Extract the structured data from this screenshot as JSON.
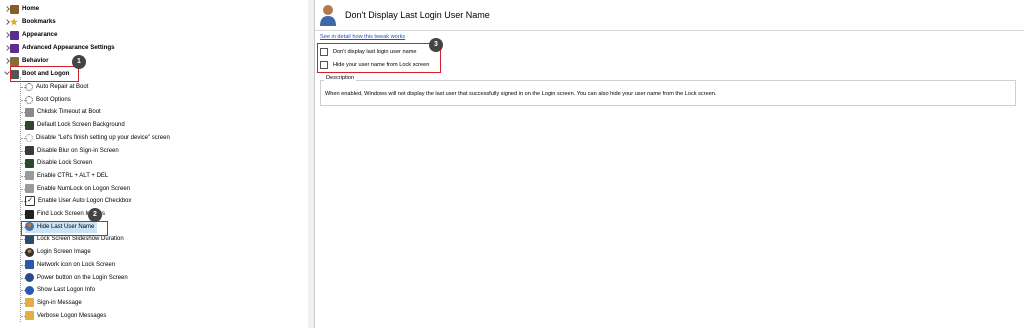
{
  "tree": {
    "top_items": [
      {
        "label": "Home",
        "icon": "home-icon",
        "color": "#8a5a2b"
      },
      {
        "label": "Bookmarks",
        "icon": "star-icon",
        "color": "#e8a317"
      },
      {
        "label": "Appearance",
        "icon": "palette-icon",
        "color": "#5b2d90"
      },
      {
        "label": "Advanced Appearance Settings",
        "icon": "palette-icon",
        "color": "#5b2d90"
      },
      {
        "label": "Behavior",
        "icon": "behavior-icon",
        "color": "#8a6a3a"
      },
      {
        "label": "Boot and Logon",
        "icon": "boot-logon-icon",
        "color": "#555555"
      }
    ],
    "children": [
      {
        "label": "Auto Repair at Boot",
        "icon": "dots-icon",
        "color": "#444444"
      },
      {
        "label": "Boot Options",
        "icon": "dots-icon",
        "color": "#444444"
      },
      {
        "label": "Chkdsk Timeout at Boot",
        "icon": "drive-icon",
        "color": "#8a8a8a"
      },
      {
        "label": "Default Lock Screen Background",
        "icon": "lock-screen-icon",
        "color": "#2a4a2a"
      },
      {
        "label": "Disable \"Let's finish setting up your device\" screen",
        "icon": "dots-icon",
        "color": "#8a8a8a"
      },
      {
        "label": "Disable Blur on Sign-in Screen",
        "icon": "image-icon",
        "color": "#3a3a3a"
      },
      {
        "label": "Disable Lock Screen",
        "icon": "lock-screen-icon",
        "color": "#2a4a2a"
      },
      {
        "label": "Enable CTRL + ALT + DEL",
        "icon": "keyboard-icon",
        "color": "#9a9a9a"
      },
      {
        "label": "Enable NumLock on Logon Screen",
        "icon": "keyboard-icon",
        "color": "#9a9a9a"
      },
      {
        "label": "Enable User Auto Logon Checkbox",
        "icon": "checkbox-icon",
        "color": "#333333"
      },
      {
        "label": "Find Lock Screen Images",
        "icon": "image-icon",
        "color": "#222222"
      },
      {
        "label": "Hide Last User Name",
        "icon": "user-icon",
        "color": "#4a6fa5"
      },
      {
        "label": "Lock Screen Slideshow Duration",
        "icon": "lock-screen-icon",
        "color": "#2a4a6a"
      },
      {
        "label": "Login Screen Image",
        "icon": "user-circle-icon",
        "color": "#333333"
      },
      {
        "label": "Network icon on Lock Screen",
        "icon": "network-icon",
        "color": "#2a5aa5"
      },
      {
        "label": "Power button on the Login Screen",
        "icon": "power-icon",
        "color": "#2a4a8a"
      },
      {
        "label": "Show Last Logon Info",
        "icon": "info-icon",
        "color": "#2a5ab0"
      },
      {
        "label": "Sign-in Message",
        "icon": "message-icon",
        "color": "#e0b040"
      },
      {
        "label": "Verbose Logon Messages",
        "icon": "message-icon",
        "color": "#e0b040"
      }
    ]
  },
  "badges": [
    "1",
    "2",
    "3"
  ],
  "panel": {
    "title": "Don't Display Last Login User Name",
    "link": "See in detail how this tweak works",
    "options": [
      "Don't display last login user name",
      "Hide your user name from Lock screen"
    ],
    "description_label": "Description",
    "description": "When enabled, Windows will not display the last user that successfully signed in on the Login screen. You can also hide your user name from the Lock screen."
  },
  "colors": {
    "highlight_border": "#d0202a",
    "badge": "#444444",
    "selected_bg": "#cce4f7",
    "link": "#1a4fd6"
  }
}
